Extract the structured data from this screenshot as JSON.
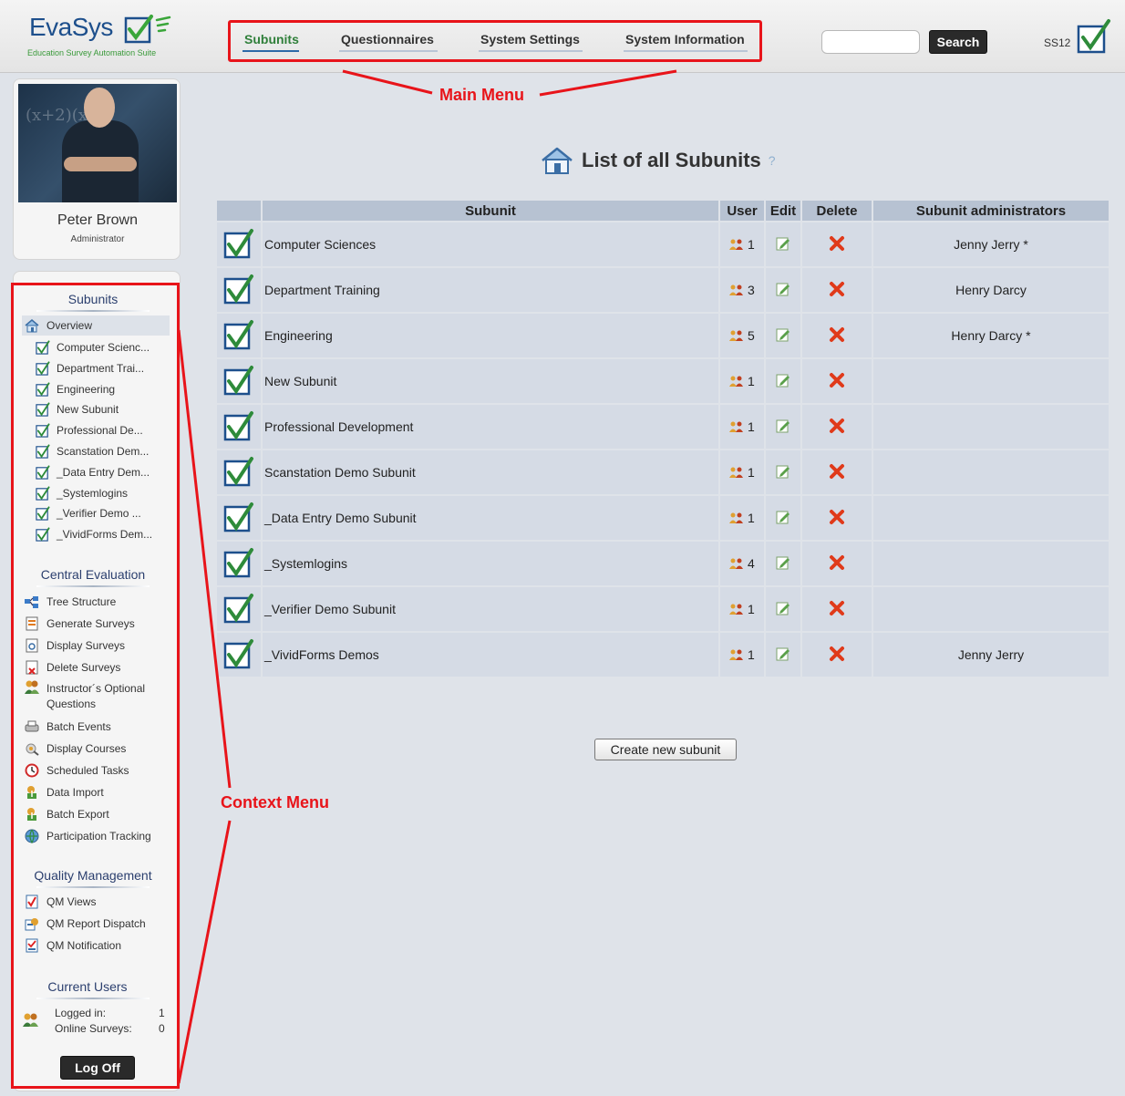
{
  "header": {
    "logo_text": "EvaSys",
    "logo_subtitle": "Education Survey Automation Suite",
    "menu": [
      {
        "label": "Subunits",
        "active": true
      },
      {
        "label": "Questionnaires",
        "active": false
      },
      {
        "label": "System Settings",
        "active": false
      },
      {
        "label": "System Information",
        "active": false
      }
    ],
    "search_placeholder": "",
    "search_label": "Search",
    "semester": "SS12"
  },
  "profile": {
    "name": "Peter Brown",
    "role": "Administrator"
  },
  "sidebar": {
    "subunits_title": "Subunits",
    "overview_label": "Overview",
    "subunit_items": [
      "Computer Scienc...",
      "Department Trai...",
      "Engineering",
      "New Subunit",
      "Professional De...",
      "Scanstation Dem...",
      "_Data Entry Dem...",
      "_Systemlogins",
      "_Verifier Demo ...",
      "_VividForms Dem..."
    ],
    "central_title": "Central Evaluation",
    "central_items": [
      {
        "label": "Tree Structure",
        "icon": "tree-structure-icon"
      },
      {
        "label": "Generate Surveys",
        "icon": "generate-surveys-icon"
      },
      {
        "label": "Display Surveys",
        "icon": "display-surveys-icon"
      },
      {
        "label": "Delete Surveys",
        "icon": "delete-surveys-icon"
      },
      {
        "label": "Instructor´s Optional",
        "label2": "Questions",
        "icon": "users-icon"
      },
      {
        "label": "Batch Events",
        "icon": "printer-icon"
      },
      {
        "label": "Display Courses",
        "icon": "courses-icon"
      },
      {
        "label": "Scheduled Tasks",
        "icon": "clock-icon"
      },
      {
        "label": "Data Import",
        "icon": "import-icon"
      },
      {
        "label": "Batch Export",
        "icon": "export-icon"
      },
      {
        "label": "Participation Tracking",
        "icon": "globe-icon"
      }
    ],
    "qm_title": "Quality Management",
    "qm_items": [
      {
        "label": "QM Views",
        "icon": "qm-views-icon"
      },
      {
        "label": "QM Report Dispatch",
        "icon": "qm-report-icon"
      },
      {
        "label": "QM Notification",
        "icon": "qm-notification-icon"
      }
    ],
    "current_users_title": "Current Users",
    "logged_in_label": "Logged in:",
    "logged_in_value": "1",
    "online_surveys_label": "Online Surveys:",
    "online_surveys_value": "0",
    "logoff_label": "Log Off"
  },
  "main": {
    "title": "List of all Subunits",
    "help": "?",
    "columns": [
      "Subunit",
      "User",
      "Edit",
      "Delete",
      "Subunit administrators"
    ],
    "rows": [
      {
        "name": "Computer Sciences",
        "users": "1",
        "admin": "Jenny Jerry *"
      },
      {
        "name": "Department Training",
        "users": "3",
        "admin": "Henry Darcy"
      },
      {
        "name": "Engineering",
        "users": "5",
        "admin": "Henry Darcy *"
      },
      {
        "name": "New Subunit",
        "users": "1",
        "admin": ""
      },
      {
        "name": "Professional Development",
        "users": "1",
        "admin": ""
      },
      {
        "name": "Scanstation Demo Subunit",
        "users": "1",
        "admin": ""
      },
      {
        "name": "_Data Entry Demo Subunit",
        "users": "1",
        "admin": ""
      },
      {
        "name": "_Systemlogins",
        "users": "4",
        "admin": ""
      },
      {
        "name": "_Verifier Demo Subunit",
        "users": "1",
        "admin": ""
      },
      {
        "name": "_VividForms Demos",
        "users": "1",
        "admin": "Jenny Jerry"
      }
    ],
    "create_label": "Create new subunit"
  },
  "annotations": {
    "main_menu": "Main Menu",
    "context_menu": "Context Menu"
  },
  "colors": {
    "accent_red": "#e8141a",
    "check_green": "#2e8b3a",
    "frame_blue": "#1d4f8c"
  }
}
